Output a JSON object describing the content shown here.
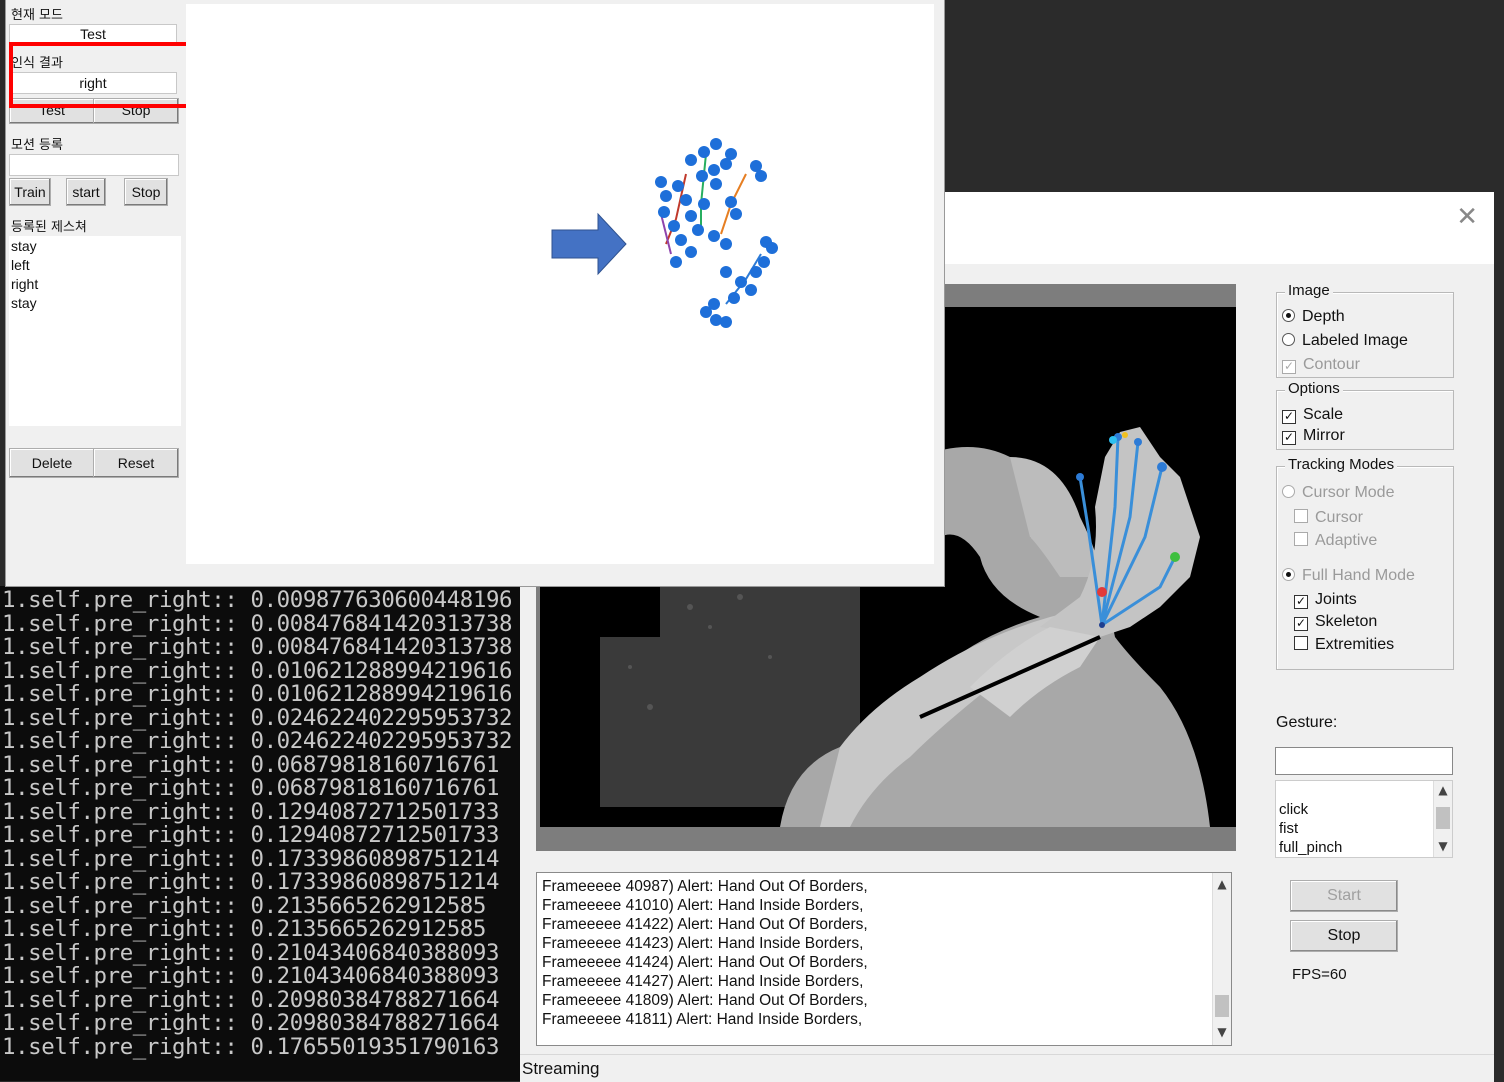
{
  "main_app": {
    "current_mode_label": "현재 모드",
    "current_mode_value": "Test",
    "result_label": "인식 결과",
    "result_value": "right",
    "test_button": "Test",
    "stop_button": "Stop",
    "motion_register_label": "모션 등록",
    "motion_input_value": "",
    "train_button": "Train",
    "start_button": "start",
    "stop2_button": "Stop",
    "registered_label": "등록된 제스쳐",
    "gestures": [
      "stay",
      "left",
      "right",
      "stay"
    ],
    "delete_button": "Delete",
    "reset_button": "Reset"
  },
  "console": {
    "lines": [
      "1.self.pre_right:: 0.009877630600448196",
      "1.self.pre_right:: 0.008476841420313738",
      "1.self.pre_right:: 0.008476841420313738",
      "1.self.pre_right:: 0.010621288994219616",
      "1.self.pre_right:: 0.010621288994219616",
      "1.self.pre_right:: 0.024622402295953732",
      "1.self.pre_right:: 0.024622402295953732",
      "1.self.pre_right:: 0.06879818160716761",
      "1.self.pre_right:: 0.06879818160716761",
      "1.self.pre_right:: 0.12940872712501733",
      "1.self.pre_right:: 0.12940872712501733",
      "1.self.pre_right:: 0.17339860898751214",
      "1.self.pre_right:: 0.17339860898751214",
      "1.self.pre_right:: 0.2135665262912585",
      "1.self.pre_right:: 0.2135665262912585",
      "1.self.pre_right:: 0.21043406840388093",
      "1.self.pre_right:: 0.21043406840388093",
      "1.self.pre_right:: 0.20980384788271664",
      "1.self.pre_right:: 0.20980384788271664",
      "1.self.pre_right:: 0.17655019351790163"
    ]
  },
  "tracker": {
    "close_glyph": "✕",
    "image_group": "Image",
    "depth": "Depth",
    "labeled_image": "Labeled Image",
    "contour": "Contour",
    "options_group": "Options",
    "scale": "Scale",
    "mirror": "Mirror",
    "tracking_group": "Tracking Modes",
    "cursor_mode": "Cursor Mode",
    "cursor": "Cursor",
    "adaptive": "Adaptive",
    "full_hand_mode": "Full Hand Mode",
    "joints": "Joints",
    "skeleton": "Skeleton",
    "extremities": "Extremities",
    "gesture_label": "Gesture:",
    "gesture_value": "",
    "gesture_list": [
      "click",
      "fist",
      "full_pinch"
    ],
    "start_button": "Start",
    "stop_button": "Stop",
    "fps": "FPS=60",
    "log": [
      "Frameeeee 40987)  Alert: Hand Out Of Borders,",
      "Frameeeee 41010)  Alert: Hand Inside Borders,",
      "Frameeeee 41422)  Alert: Hand Out Of Borders,",
      "Frameeeee 41423)  Alert: Hand Inside Borders,",
      "Frameeeee 41424)  Alert: Hand Out Of Borders,",
      "Frameeeee 41427)  Alert: Hand Inside Borders,",
      "Frameeeee 41809)  Alert: Hand Out Of Borders,",
      "Frameeeee 41811)  Alert: Hand Inside Borders,"
    ],
    "status": "Streaming"
  },
  "icons": {
    "arrow": "right-arrow-icon",
    "colors": {
      "arrow": "#4472c4",
      "joint": "#1e6fd9",
      "highlight": "#ff0000"
    }
  }
}
